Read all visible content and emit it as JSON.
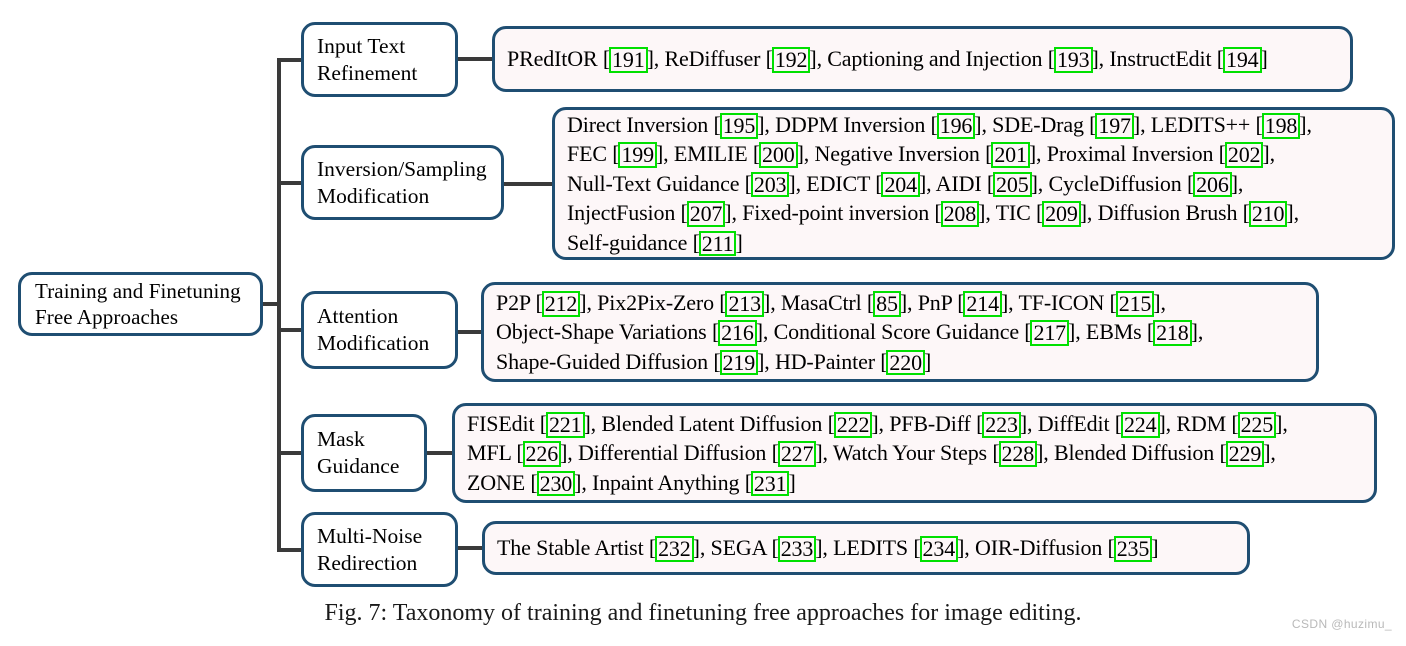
{
  "figure": {
    "caption": "Fig. 7: Taxonomy of training and finetuning free approaches for image editing.",
    "watermark": "CSDN @huzimu_",
    "colors": {
      "box_border": "#1f4e72",
      "content_fill": "#fdf7f8",
      "citation_highlight": "#00e000",
      "connector": "#3a3a3a",
      "page_background": "#ffffff"
    }
  },
  "root": {
    "label": "Training and Finetuning\nFree Approaches"
  },
  "branches": [
    {
      "category": "Input Text\nRefinement",
      "lines": [
        [
          {
            "t": "PRedItOR ["
          },
          {
            "c": "191"
          },
          {
            "t": "], ReDiffuser ["
          },
          {
            "c": "192"
          },
          {
            "t": "], Captioning and Injection ["
          },
          {
            "c": "193"
          },
          {
            "t": "], InstructEdit ["
          },
          {
            "c": "194"
          },
          {
            "t": "]"
          }
        ]
      ]
    },
    {
      "category": "Inversion/Sampling\nModification",
      "lines": [
        [
          {
            "t": "Direct Inversion ["
          },
          {
            "c": "195"
          },
          {
            "t": "], DDPM Inversion ["
          },
          {
            "c": "196"
          },
          {
            "t": "], SDE-Drag ["
          },
          {
            "c": "197"
          },
          {
            "t": "], LEDITS++ ["
          },
          {
            "c": "198"
          },
          {
            "t": "],"
          }
        ],
        [
          {
            "t": "FEC ["
          },
          {
            "c": "199"
          },
          {
            "t": "], EMILIE ["
          },
          {
            "c": "200"
          },
          {
            "t": "], Negative Inversion ["
          },
          {
            "c": "201"
          },
          {
            "t": "], Proximal Inversion ["
          },
          {
            "c": "202"
          },
          {
            "t": "],"
          }
        ],
        [
          {
            "t": "Null-Text Guidance ["
          },
          {
            "c": "203"
          },
          {
            "t": "], EDICT ["
          },
          {
            "c": "204"
          },
          {
            "t": "], AIDI ["
          },
          {
            "c": "205"
          },
          {
            "t": "], CycleDiffusion ["
          },
          {
            "c": "206"
          },
          {
            "t": "],"
          }
        ],
        [
          {
            "t": "InjectFusion ["
          },
          {
            "c": "207"
          },
          {
            "t": "], Fixed-point inversion ["
          },
          {
            "c": "208"
          },
          {
            "t": "], TIC ["
          },
          {
            "c": "209"
          },
          {
            "t": "], Diffusion Brush ["
          },
          {
            "c": "210"
          },
          {
            "t": "],"
          }
        ],
        [
          {
            "t": "Self-guidance ["
          },
          {
            "c": "211"
          },
          {
            "t": "]"
          }
        ]
      ]
    },
    {
      "category": "Attention\nModification",
      "lines": [
        [
          {
            "t": "P2P ["
          },
          {
            "c": "212"
          },
          {
            "t": "], Pix2Pix-Zero ["
          },
          {
            "c": "213"
          },
          {
            "t": "], MasaCtrl ["
          },
          {
            "c": "85"
          },
          {
            "t": "], PnP ["
          },
          {
            "c": "214"
          },
          {
            "t": "], TF-ICON ["
          },
          {
            "c": "215"
          },
          {
            "t": "],"
          }
        ],
        [
          {
            "t": "Object-Shape Variations ["
          },
          {
            "c": "216"
          },
          {
            "t": "], Conditional Score Guidance ["
          },
          {
            "c": "217"
          },
          {
            "t": "], EBMs ["
          },
          {
            "c": "218"
          },
          {
            "t": "],"
          }
        ],
        [
          {
            "t": "Shape-Guided Diffusion ["
          },
          {
            "c": "219"
          },
          {
            "t": "], HD-Painter ["
          },
          {
            "c": "220"
          },
          {
            "t": "]"
          }
        ]
      ]
    },
    {
      "category": "Mask\nGuidance",
      "lines": [
        [
          {
            "t": "FISEdit ["
          },
          {
            "c": "221"
          },
          {
            "t": "], Blended Latent Diffusion ["
          },
          {
            "c": "222"
          },
          {
            "t": "], PFB-Diff ["
          },
          {
            "c": "223"
          },
          {
            "t": "], DiffEdit ["
          },
          {
            "c": "224"
          },
          {
            "t": "], RDM ["
          },
          {
            "c": "225"
          },
          {
            "t": "],"
          }
        ],
        [
          {
            "t": "MFL ["
          },
          {
            "c": "226"
          },
          {
            "t": "], Differential Diffusion ["
          },
          {
            "c": "227"
          },
          {
            "t": "], Watch Your Steps ["
          },
          {
            "c": "228"
          },
          {
            "t": "], Blended Diffusion ["
          },
          {
            "c": "229"
          },
          {
            "t": "],"
          }
        ],
        [
          {
            "t": "ZONE ["
          },
          {
            "c": "230"
          },
          {
            "t": "], Inpaint Anything ["
          },
          {
            "c": "231"
          },
          {
            "t": "]"
          }
        ]
      ]
    },
    {
      "category": "Multi-Noise\nRedirection",
      "lines": [
        [
          {
            "t": "The Stable Artist ["
          },
          {
            "c": "232"
          },
          {
            "t": "], SEGA ["
          },
          {
            "c": "233"
          },
          {
            "t": "], LEDITS ["
          },
          {
            "c": "234"
          },
          {
            "t": "], OIR-Diffusion ["
          },
          {
            "c": "235"
          },
          {
            "t": "]"
          }
        ]
      ]
    }
  ]
}
